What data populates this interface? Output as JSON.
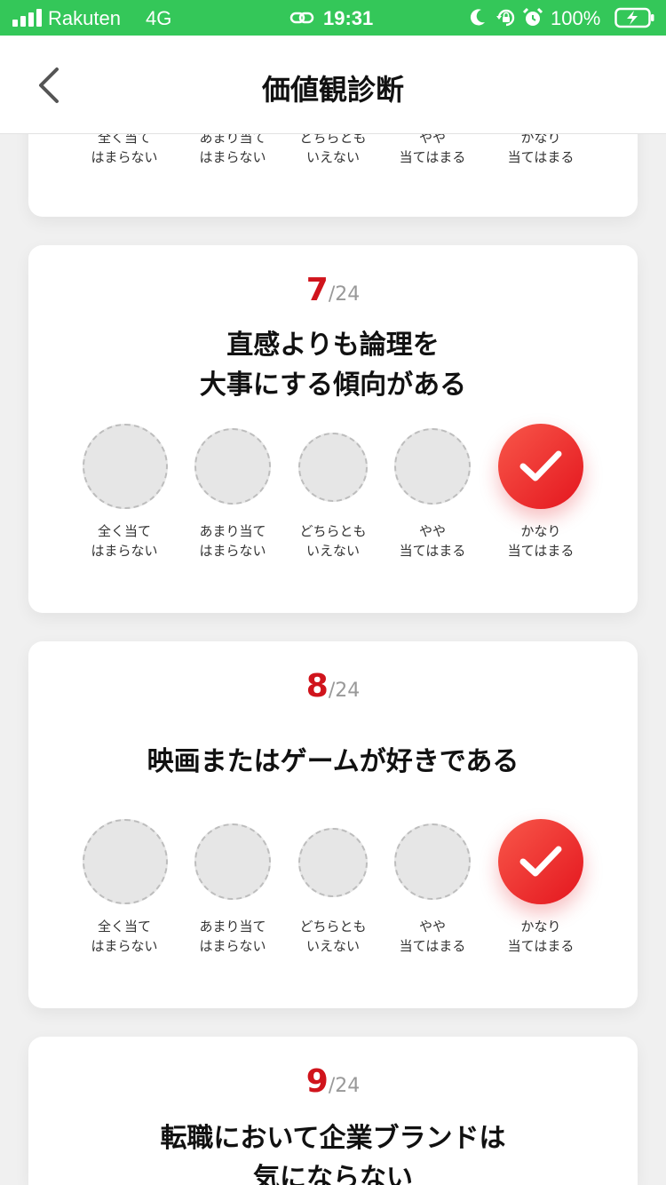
{
  "status_bar": {
    "carrier": "Rakuten",
    "network": "4G",
    "time": "19:31",
    "battery": "100%",
    "icons": [
      "signal-icon",
      "link-icon",
      "moon-icon",
      "rotation-lock-icon",
      "alarm-icon",
      "battery-charging-icon"
    ]
  },
  "header": {
    "title": "価値観診断",
    "back_icon": "chevron-left-icon"
  },
  "options": [
    {
      "line1": "全く当て",
      "line2": "はまらない"
    },
    {
      "line1": "あまり当て",
      "line2": "はまらない"
    },
    {
      "line1": "どちらとも",
      "line2": "いえない"
    },
    {
      "line1": "やや",
      "line2": "当てはまる"
    },
    {
      "line1": "かなり",
      "line2": "当てはまる"
    }
  ],
  "questions": [
    {
      "number": "7",
      "total": "/24",
      "line1": "直感よりも論理を",
      "line2": "大事にする傾向がある",
      "selected_option": "かなり当てはまる"
    },
    {
      "number": "8",
      "total": "/24",
      "line1": "映画またはゲームが好きである",
      "line2": "",
      "selected_option": "かなり当てはまる"
    },
    {
      "number": "9",
      "total": "/24",
      "line1": "転職において企業ブランドは",
      "line2": "気にならない",
      "selected_option": ""
    }
  ],
  "colors": {
    "status_bar": "#34c759",
    "accent": "#d0141c",
    "selected_gradient_start": "#f8574a",
    "selected_gradient_end": "#e4161e",
    "background": "#f0f0f0"
  },
  "check_icon": "checkmark-icon"
}
